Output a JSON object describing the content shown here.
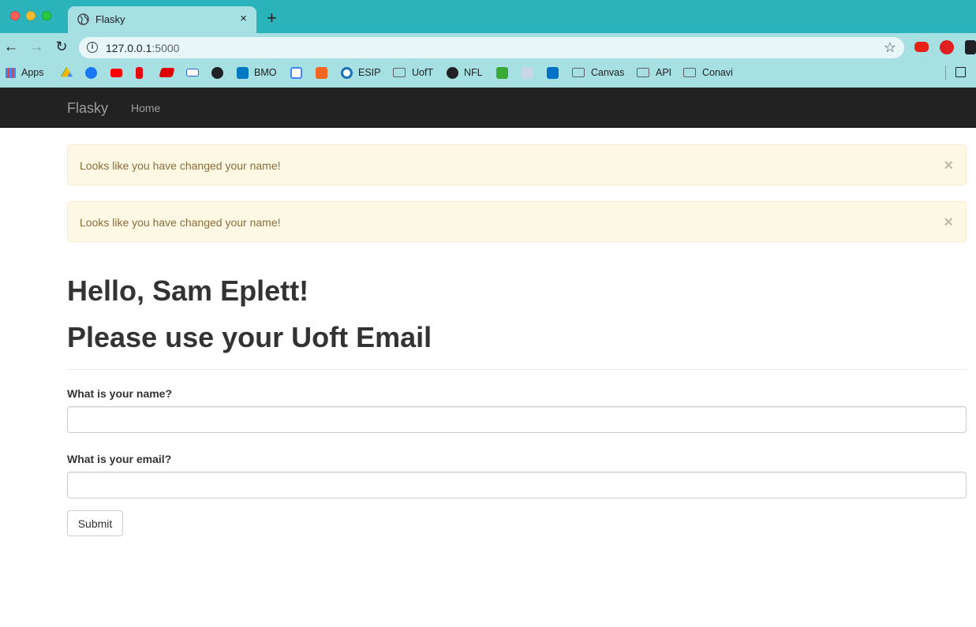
{
  "browser": {
    "tab_title": "Flasky",
    "tab_close": "×",
    "new_tab": "+",
    "url_host": "127.0.0.1",
    "url_port": ":5000",
    "bookmarks": [
      {
        "label": "Apps",
        "icon": "apps-grid-icon"
      },
      {
        "label": "",
        "icon": "google-drive-icon"
      },
      {
        "label": "",
        "icon": "facebook-icon"
      },
      {
        "label": "",
        "icon": "youtube-icon"
      },
      {
        "label": "",
        "icon": "netflix-icon"
      },
      {
        "label": "",
        "icon": "espn-icon"
      },
      {
        "label": "",
        "icon": "ecf-icon"
      },
      {
        "label": "",
        "icon": "globe-icon"
      },
      {
        "label": "BMO",
        "icon": "bmo-icon"
      },
      {
        "label": "",
        "icon": "calendar-icon"
      },
      {
        "label": "",
        "icon": "c-icon"
      },
      {
        "label": "ESIP",
        "icon": "esip-icon"
      },
      {
        "label": "UofT",
        "icon": "folder-icon"
      },
      {
        "label": "NFL",
        "icon": "nfl-icon"
      },
      {
        "label": "",
        "icon": "green-logo-icon"
      },
      {
        "label": "",
        "icon": "soccer-icon"
      },
      {
        "label": "",
        "icon": "outlook-icon"
      },
      {
        "label": "Canvas",
        "icon": "folder-icon"
      },
      {
        "label": "API",
        "icon": "folder-icon"
      },
      {
        "label": "Conavi",
        "icon": "folder-icon"
      }
    ]
  },
  "navbar": {
    "brand": "Flasky",
    "links": [
      "Home"
    ]
  },
  "alerts": [
    {
      "message": "Looks like you have changed your name!",
      "dismiss": "×"
    },
    {
      "message": "Looks like you have changed your name!",
      "dismiss": "×"
    }
  ],
  "page": {
    "greeting": "Hello, Sam Eplett!",
    "subheading": "Please use your Uoft Email"
  },
  "form": {
    "name_label": "What is your name?",
    "name_value": "",
    "email_label": "What is your email?",
    "email_value": "",
    "submit_label": "Submit"
  },
  "colors": {
    "tabstrip": "#2ab3bb",
    "toolbar": "#a6e0e2",
    "navbar": "#222222",
    "alert_bg": "#fcf8e3",
    "alert_text": "#8a6d3b"
  }
}
